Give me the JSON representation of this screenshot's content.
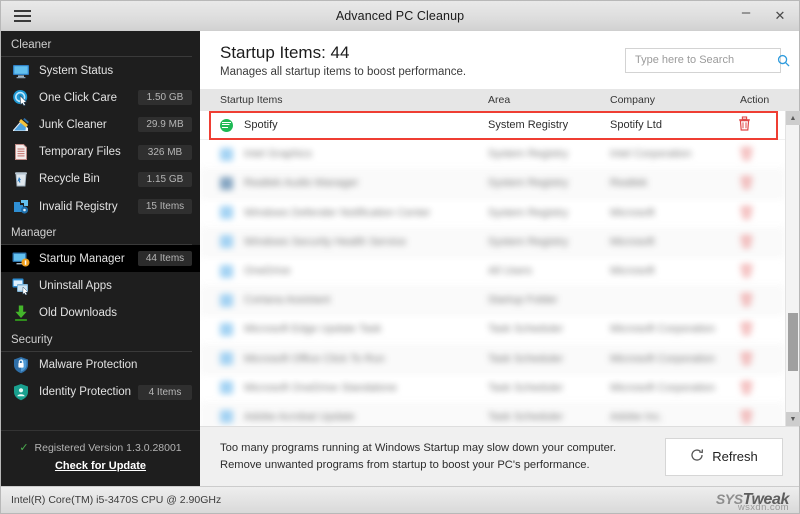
{
  "window": {
    "title": "Advanced PC Cleanup",
    "menu_icon": "hamburger-icon",
    "minimize_label": "–",
    "close_label": "✕"
  },
  "sidebar": {
    "groups": [
      {
        "label": "Cleaner",
        "items": [
          {
            "icon": "monitor-icon",
            "label": "System Status",
            "badge": ""
          },
          {
            "icon": "one-click-care-icon",
            "label": "One Click Care",
            "badge": "1.50 GB"
          },
          {
            "icon": "broom-icon",
            "label": "Junk Cleaner",
            "badge": "29.9 MB"
          },
          {
            "icon": "document-icon",
            "label": "Temporary Files",
            "badge": "326 MB"
          },
          {
            "icon": "recycle-bin-icon",
            "label": "Recycle Bin",
            "badge": "1.15 GB"
          },
          {
            "icon": "registry-icon",
            "label": "Invalid Registry",
            "badge": "15 Items"
          }
        ]
      },
      {
        "label": "Manager",
        "items": [
          {
            "icon": "startup-manager-icon",
            "label": "Startup Manager",
            "badge": "44 Items",
            "active": true
          },
          {
            "icon": "uninstall-icon",
            "label": "Uninstall Apps",
            "badge": ""
          },
          {
            "icon": "download-icon",
            "label": "Old Downloads",
            "badge": ""
          }
        ]
      },
      {
        "label": "Security",
        "items": [
          {
            "icon": "shield-malware-icon",
            "label": "Malware Protection",
            "badge": ""
          },
          {
            "icon": "shield-identity-icon",
            "label": "Identity Protection",
            "badge": "4 Items"
          }
        ]
      }
    ],
    "footer": {
      "check_icon": "check-icon",
      "registered_text": "Registered Version 1.3.0.28001",
      "update_link": "Check for Update"
    }
  },
  "main": {
    "title": "Startup Items: 44",
    "subtitle": "Manages all startup items to boost performance.",
    "search": {
      "placeholder": "Type here to Search",
      "value": "",
      "icon": "search-icon"
    },
    "columns": [
      "Startup Items",
      "Area",
      "Company",
      "Action"
    ],
    "rows": [
      {
        "name": "Spotify",
        "area": "System Registry",
        "company": "Spotify Ltd",
        "action_icon": "trash-icon",
        "icon": "spotify-icon",
        "highlighted": true,
        "blurred": false
      },
      {
        "name": "",
        "area": "",
        "company": "",
        "action_icon": "trash-icon",
        "icon": "app-icon",
        "blurred": true
      },
      {
        "name": "",
        "area": "",
        "company": "",
        "action_icon": "trash-icon",
        "icon": "app-icon",
        "blurred": true
      },
      {
        "name": "",
        "area": "",
        "company": "",
        "action_icon": "trash-icon",
        "icon": "app-icon",
        "blurred": true
      },
      {
        "name": "",
        "area": "",
        "company": "",
        "action_icon": "trash-icon",
        "icon": "app-icon",
        "blurred": true
      },
      {
        "name": "",
        "area": "",
        "company": "",
        "action_icon": "trash-icon",
        "icon": "app-icon",
        "blurred": true
      },
      {
        "name": "",
        "area": "",
        "company": "",
        "action_icon": "trash-icon",
        "icon": "app-icon",
        "blurred": true
      },
      {
        "name": "",
        "area": "",
        "company": "",
        "action_icon": "trash-icon",
        "icon": "app-icon",
        "blurred": true
      },
      {
        "name": "",
        "area": "",
        "company": "",
        "action_icon": "trash-icon",
        "icon": "app-icon",
        "blurred": true
      },
      {
        "name": "",
        "area": "",
        "company": "",
        "action_icon": "trash-icon",
        "icon": "app-icon",
        "blurred": true
      },
      {
        "name": "",
        "area": "",
        "company": "",
        "action_icon": "trash-icon",
        "icon": "app-icon",
        "blurred": true
      }
    ],
    "scrollbar": {
      "up_icon": "caret-up-icon",
      "down_icon": "caret-down-icon"
    }
  },
  "notice": {
    "line1": "Too many programs running at Windows Startup may slow down your computer.",
    "line2": "Remove unwanted programs from startup to boost your PC's performance.",
    "refresh_label": "Refresh",
    "refresh_icon": "refresh-icon"
  },
  "statusbar": {
    "cpu": "Intel(R) Core(TM) i5-3470S CPU @ 2.90GHz",
    "brand_prefix": "SYS",
    "brand_name": "Tweak",
    "watermark": "wsxdn.com"
  },
  "colors": {
    "accent_red": "#ef3e33",
    "accent_blue": "#2e9bdd",
    "spotify_green": "#1db954",
    "sidebar_bg": "#1e1e1e"
  }
}
